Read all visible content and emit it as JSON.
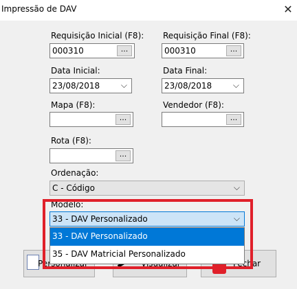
{
  "window": {
    "title": "Impressão de DAV",
    "close_glyph": "✕"
  },
  "fields": {
    "req_inicial": {
      "label": "Requisição Inicial (F8):",
      "value": "000310",
      "button": "..."
    },
    "req_final": {
      "label": "Requisição Final (F8):",
      "value": "000310",
      "button": "..."
    },
    "data_inicial": {
      "label": "Data Inicial:",
      "value": "23/08/2018"
    },
    "data_final": {
      "label": "Data Final:",
      "value": "23/08/2018"
    },
    "mapa": {
      "label": "Mapa (F8):",
      "value": "",
      "button": "..."
    },
    "vendedor": {
      "label": "Vendedor (F8):",
      "value": "",
      "button": "..."
    },
    "rota": {
      "label": "Rota (F8):",
      "value": "",
      "button": "..."
    },
    "ordenacao": {
      "label": "Ordenação:",
      "value": "C - Código"
    },
    "modelo": {
      "label": "Modelo:",
      "value": "33 - DAV Personalizado",
      "options": [
        "33 - DAV Personalizado",
        "35 - DAV Matricial Personalizado"
      ],
      "selected_index": 0
    }
  },
  "buttons": {
    "personalizar": "Personalizar",
    "visualizar": "Visualizar",
    "fechar": "Fechar"
  },
  "colors": {
    "highlight": "#e0202a",
    "selection": "#0078d7"
  }
}
